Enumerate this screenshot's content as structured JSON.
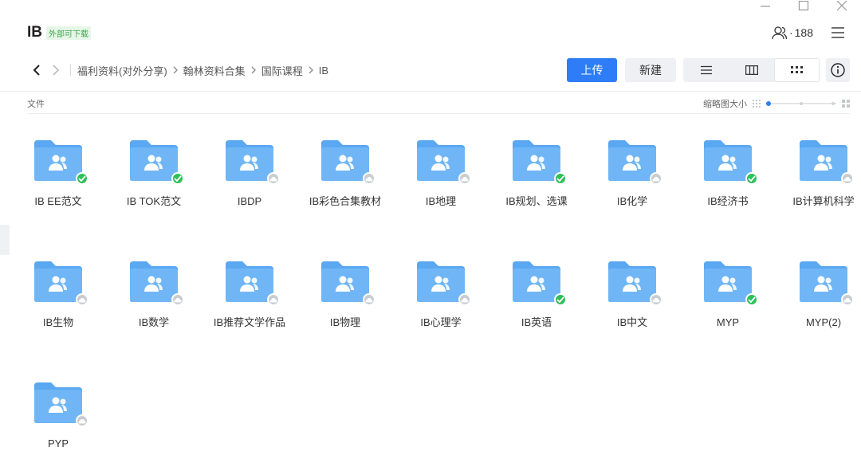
{
  "window": {
    "controls": [
      "minimize-icon",
      "maximize-icon",
      "close-icon"
    ]
  },
  "header": {
    "title": "IB",
    "tag": "外部可下载",
    "member_count": "188"
  },
  "breadcrumb": [
    "福利资料(对外分享)",
    "翰林资料合集",
    "国际课程",
    "IB"
  ],
  "toolbar": {
    "upload_label": "上传",
    "new_label": "新建",
    "view_modes": [
      "list-view-icon",
      "column-view-icon",
      "grid-view-icon"
    ],
    "active_view": "grid"
  },
  "subheader": {
    "section_label": "文件",
    "thumb_size_label": "缩略图大小"
  },
  "colors": {
    "accent": "#2f7df6",
    "folder": "#5aa7f2",
    "synced": "#2fbf59",
    "cloud": "#c9ccd1"
  },
  "folders": [
    {
      "name": "IB EE范文",
      "status": "synced"
    },
    {
      "name": "IB TOK范文",
      "status": "synced"
    },
    {
      "name": "IBDP",
      "status": "cloud"
    },
    {
      "name": "IB彩色合集教材",
      "status": "cloud"
    },
    {
      "name": "IB地理",
      "status": "cloud"
    },
    {
      "name": "IB规划、选课",
      "status": "synced"
    },
    {
      "name": "IB化学",
      "status": "cloud"
    },
    {
      "name": "IB经济书",
      "status": "synced"
    },
    {
      "name": "IB计算机科学",
      "status": "cloud"
    },
    {
      "name": "IB生物",
      "status": "cloud"
    },
    {
      "name": "IB数学",
      "status": "cloud"
    },
    {
      "name": "IB推荐文学作品",
      "status": "cloud"
    },
    {
      "name": "IB物理",
      "status": "cloud"
    },
    {
      "name": "IB心理学",
      "status": "cloud"
    },
    {
      "name": "IB英语",
      "status": "synced"
    },
    {
      "name": "IB中文",
      "status": "cloud"
    },
    {
      "name": "MYP",
      "status": "synced"
    },
    {
      "name": "MYP(2)",
      "status": "cloud"
    },
    {
      "name": "PYP",
      "status": "cloud"
    }
  ]
}
